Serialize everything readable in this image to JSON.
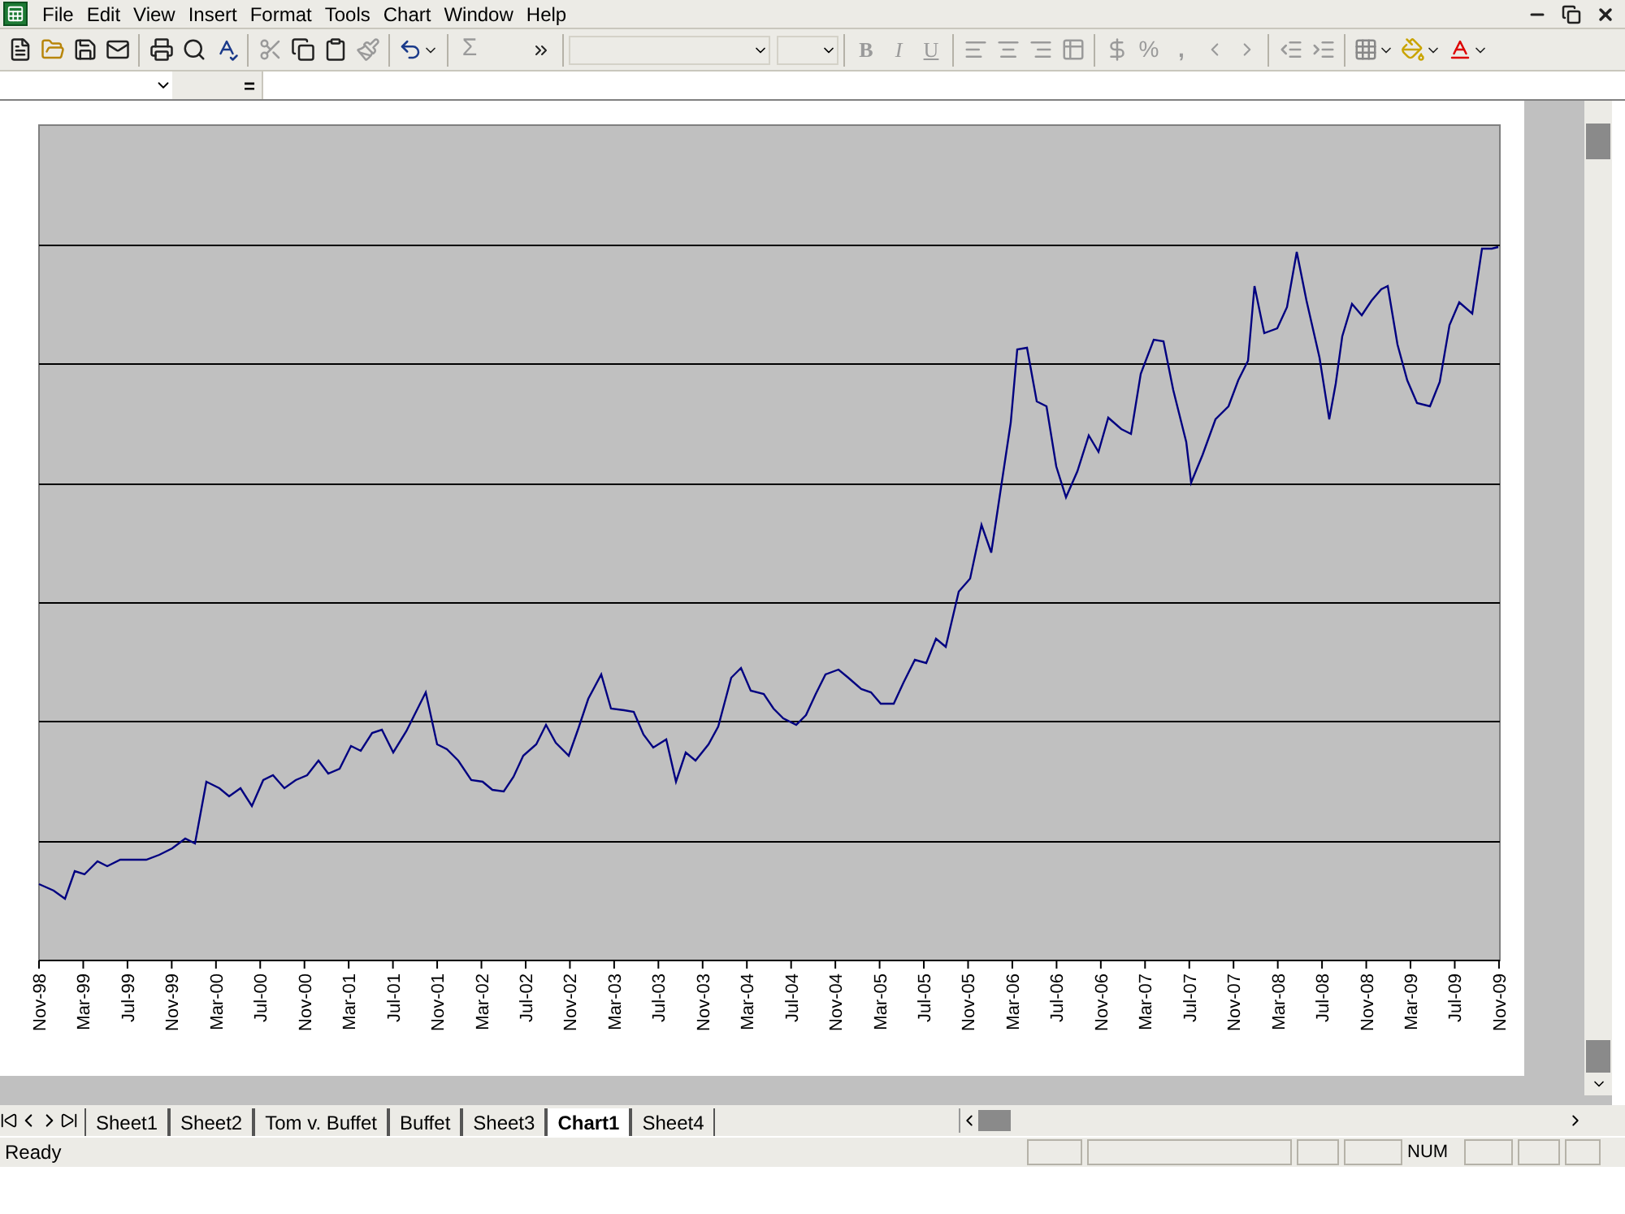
{
  "menu": [
    "File",
    "Edit",
    "View",
    "Insert",
    "Format",
    "Tools",
    "Chart",
    "Window",
    "Help"
  ],
  "toolbar": {
    "sum": "Σ",
    "bold": "B",
    "italic": "I",
    "underline": "U",
    "percent": "%",
    "comma": ","
  },
  "formula_bar": {
    "equals": "="
  },
  "x_axis_labels": [
    "Nov-98",
    "Mar-99",
    "Jul-99",
    "Nov-99",
    "Mar-00",
    "Jul-00",
    "Nov-00",
    "Mar-01",
    "Jul-01",
    "Nov-01",
    "Mar-02",
    "Jul-02",
    "Nov-02",
    "Mar-03",
    "Jul-03",
    "Nov-03",
    "Mar-04",
    "Jul-04",
    "Nov-04",
    "Mar-05",
    "Jul-05",
    "Nov-05",
    "Mar-06",
    "Jul-06",
    "Nov-06",
    "Mar-07",
    "Jul-07",
    "Nov-07",
    "Mar-08",
    "Jul-08",
    "Nov-08",
    "Mar-09",
    "Jul-09",
    "Nov-09"
  ],
  "sheet_tabs": [
    {
      "label": "Sheet1",
      "selected": false
    },
    {
      "label": "Sheet2",
      "selected": false
    },
    {
      "label": "Tom v. Buffet",
      "selected": false
    },
    {
      "label": "Buffet",
      "selected": false
    },
    {
      "label": "Sheet3",
      "selected": false
    },
    {
      "label": "Chart1",
      "selected": true
    },
    {
      "label": "Sheet4",
      "selected": false
    }
  ],
  "status_bar": {
    "status": "Ready",
    "num": "NUM"
  }
}
